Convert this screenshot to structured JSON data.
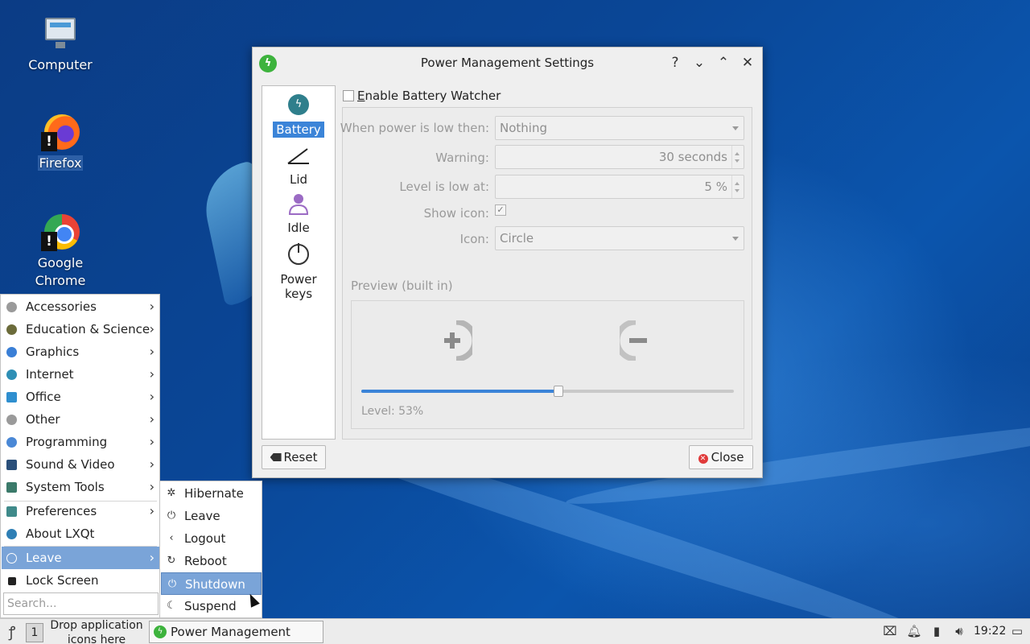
{
  "desktop": {
    "icons": [
      {
        "label": "Computer"
      },
      {
        "label": "Firefox"
      },
      {
        "label": "Google Chrome"
      }
    ]
  },
  "dialog": {
    "title": "Power Management Settings",
    "titlebar_buttons": {
      "help": "?",
      "minimize": "⌄",
      "maximize": "⌃",
      "close": "✕"
    },
    "sidebar": [
      {
        "label": "Battery",
        "icon": "battery-icon",
        "active": true
      },
      {
        "label": "Lid",
        "icon": "lid-icon"
      },
      {
        "label": "Idle",
        "icon": "idle-icon"
      },
      {
        "label": "Power keys",
        "icon": "power-icon"
      }
    ],
    "enable_battery_watcher": {
      "label_prefix": "E",
      "label_rest": "nable Battery Watcher",
      "checked": false
    },
    "fields": {
      "low_action_label": "When power is low then:",
      "low_action_value": "Nothing",
      "warning_label": "Warning:",
      "warning_value": "30 seconds",
      "level_low_label": "Level is low at:",
      "level_low_value": "5 %",
      "show_icon_label": "Show icon:",
      "show_icon_checked": "✓",
      "icon_label": "Icon:",
      "icon_value": "Circle"
    },
    "preview": {
      "label": "Preview (built in)",
      "level_text": "Level: 53%",
      "level_fraction": 0.53
    },
    "buttons": {
      "reset": "Reset",
      "close": "Close"
    },
    "accent_color": "#3b84d8"
  },
  "start_menu": {
    "items": [
      {
        "label": "Accessories",
        "icon": "accessories-icon",
        "color": "#9a9a9a"
      },
      {
        "label": "Education & Science",
        "icon": "education-icon",
        "color": "#6b6b3a"
      },
      {
        "label": "Graphics",
        "icon": "graphics-icon",
        "color": "#3a7fd6"
      },
      {
        "label": "Internet",
        "icon": "internet-icon",
        "color": "#2e8fb5"
      },
      {
        "label": "Office",
        "icon": "office-icon",
        "color": "#2f8fcf"
      },
      {
        "label": "Other",
        "icon": "other-icon",
        "color": "#9a9a9a"
      },
      {
        "label": "Programming",
        "icon": "programming-icon",
        "color": "#4a88d6"
      },
      {
        "label": "Sound & Video",
        "icon": "sound-video-icon",
        "color": "#2a4f7a"
      },
      {
        "label": "System Tools",
        "icon": "system-tools-icon",
        "color": "#3b7a6a"
      },
      {
        "label": "Preferences",
        "icon": "preferences-icon",
        "color": "#3f8a8a"
      },
      {
        "label": "About LXQt",
        "icon": "lxqt-icon",
        "color": "#2e7fb5"
      },
      {
        "label": "Leave",
        "icon": "leave-icon",
        "color": "#ffffff",
        "active": true
      },
      {
        "label": "Lock Screen",
        "icon": "lock-icon",
        "color": "#222222"
      }
    ],
    "search_placeholder": "Search..."
  },
  "leave_submenu": {
    "items": [
      {
        "label": "Hibernate",
        "glyph": "✲"
      },
      {
        "label": "Leave",
        "glyph": "⏻"
      },
      {
        "label": "Logout",
        "glyph": "‹"
      },
      {
        "label": "Reboot",
        "glyph": "↻"
      },
      {
        "label": "Shutdown",
        "glyph": "⏻",
        "active": true
      },
      {
        "label": "Suspend",
        "glyph": "☾"
      }
    ]
  },
  "taskbar": {
    "desktop_number": "1",
    "quicklaunch_text": "Drop application icons here",
    "task_label": "Power Management Sett...",
    "clock": "19:22"
  }
}
